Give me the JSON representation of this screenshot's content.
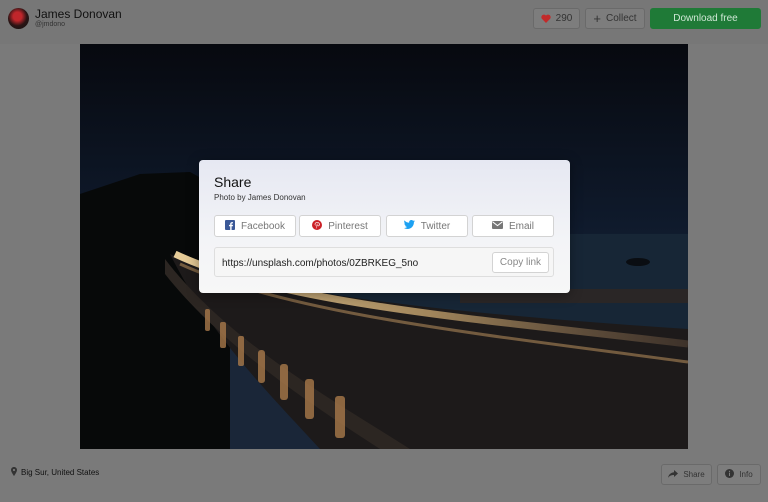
{
  "user": {
    "name": "James Donovan",
    "handle": "@jmdono"
  },
  "actions": {
    "like_count": "290",
    "collect_label": "Collect",
    "download_label": "Download free"
  },
  "photo": {
    "location": "Big Sur, United States"
  },
  "footer": {
    "share_label": "Share",
    "info_label": "Info"
  },
  "share_modal": {
    "title": "Share",
    "subtitle": "Photo by James Donovan",
    "buttons": [
      {
        "label": "Facebook",
        "icon": "facebook-icon",
        "color": "#3b5998"
      },
      {
        "label": "Pinterest",
        "icon": "pinterest-icon",
        "color": "#cb2027"
      },
      {
        "label": "Twitter",
        "icon": "twitter-icon",
        "color": "#1da1f2"
      },
      {
        "label": "Email",
        "icon": "email-icon",
        "color": "#777777"
      }
    ],
    "link_url": "https://unsplash.com/photos/0ZBRKEG_5no",
    "copy_label": "Copy link"
  },
  "colors": {
    "download_green": "#1f7a37",
    "heart_red": "#c22a2a"
  }
}
